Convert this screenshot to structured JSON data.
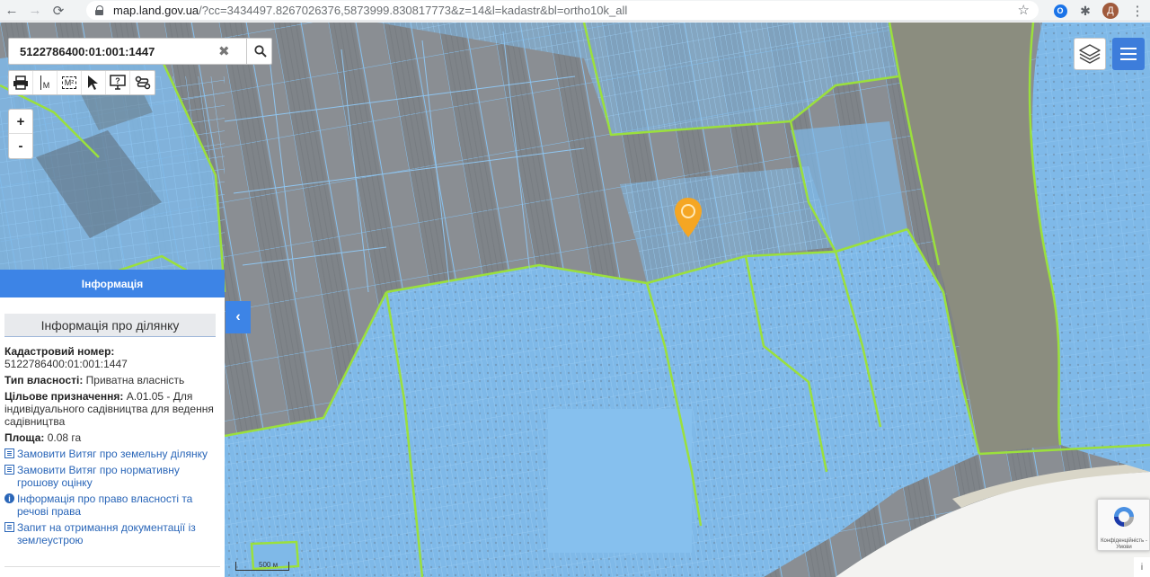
{
  "browser": {
    "url_host": "map.land.gov.ua",
    "url_path": "/?cc=3434497.8267026376,5873999.830817773&z=14&l=kadastr&bl=ortho10k_all",
    "avatar_letter": "Д"
  },
  "search": {
    "value": "5122786400:01:001:1447"
  },
  "toolbar": {
    "measure_length_label": "M",
    "measure_area_label": "M²"
  },
  "zoom": {
    "in_label": "+",
    "out_label": "-"
  },
  "panel": {
    "header": "Інформація",
    "subheader": "Інформація про ділянку",
    "cadastral_label": "Кадастровий номер:",
    "cadastral_value": "5122786400:01:001:1447",
    "ownership_label": "Тип власності:",
    "ownership_value": "Приватна власність",
    "purpose_label": "Цільове призначення:",
    "purpose_value": "А.01.05 - Для індивідуального садівництва для ведення садівництва",
    "area_label": "Площа:",
    "area_value": "0.08 га",
    "links": [
      "Замовити Витяг про земельну ділянку",
      "Замовити Витяг про нормативну грошову оцінку",
      "Інформація про право власності та речові права",
      "Запит на отримання документації із землеустрою"
    ]
  },
  "map": {
    "scale_label": "500 м",
    "recaptcha_text": "Конфіденційність - Умови",
    "info_label": "i"
  },
  "colors": {
    "parcel_fill": "#7fb9e8",
    "boundary_green": "#9be03c",
    "marker": "#f5a623",
    "panel_accent": "#3d84e6",
    "river": "#8a8d7e"
  }
}
